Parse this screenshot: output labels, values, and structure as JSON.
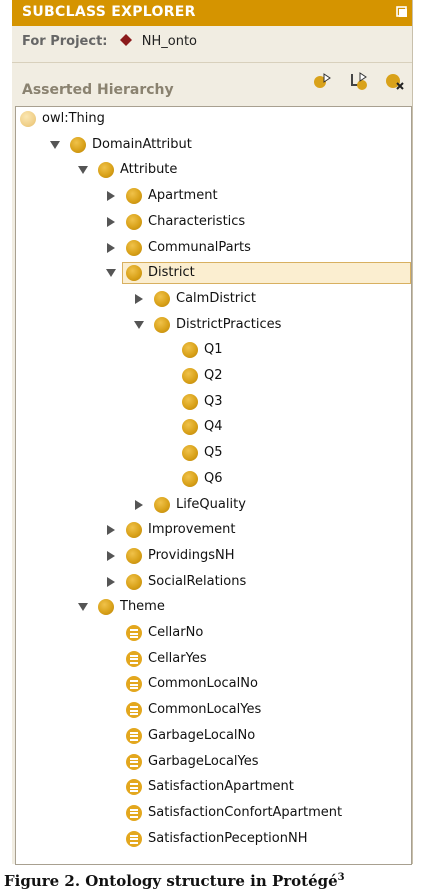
{
  "window": {
    "title": "SUBCLASS EXPLORER"
  },
  "project": {
    "label": "For Project:",
    "name": "NH_onto"
  },
  "hierarchy_label": "Asserted Hierarchy",
  "tree": [
    {
      "label": "owl:Thing",
      "depth": 0,
      "arrow": "none",
      "icon": "owl"
    },
    {
      "label": "DomainAttribut",
      "depth": 1,
      "arrow": "down",
      "icon": "class"
    },
    {
      "label": "Attribute",
      "depth": 2,
      "arrow": "down",
      "icon": "class"
    },
    {
      "label": "Apartment",
      "depth": 3,
      "arrow": "right",
      "icon": "class"
    },
    {
      "label": "Characteristics",
      "depth": 3,
      "arrow": "right",
      "icon": "class"
    },
    {
      "label": "CommunalParts",
      "depth": 3,
      "arrow": "right",
      "icon": "class"
    },
    {
      "label": "District",
      "depth": 3,
      "arrow": "down",
      "icon": "class",
      "selected": true
    },
    {
      "label": "CalmDistrict",
      "depth": 4,
      "arrow": "right",
      "icon": "class"
    },
    {
      "label": "DistrictPractices",
      "depth": 4,
      "arrow": "down",
      "icon": "class"
    },
    {
      "label": "Q1",
      "depth": 5,
      "arrow": "none",
      "icon": "class"
    },
    {
      "label": "Q2",
      "depth": 5,
      "arrow": "none",
      "icon": "class"
    },
    {
      "label": "Q3",
      "depth": 5,
      "arrow": "none",
      "icon": "class"
    },
    {
      "label": "Q4",
      "depth": 5,
      "arrow": "none",
      "icon": "class"
    },
    {
      "label": "Q5",
      "depth": 5,
      "arrow": "none",
      "icon": "class"
    },
    {
      "label": "Q6",
      "depth": 5,
      "arrow": "none",
      "icon": "class"
    },
    {
      "label": "LifeQuality",
      "depth": 4,
      "arrow": "right",
      "icon": "class"
    },
    {
      "label": "Improvement",
      "depth": 3,
      "arrow": "right",
      "icon": "class"
    },
    {
      "label": "ProvidingsNH",
      "depth": 3,
      "arrow": "right",
      "icon": "class"
    },
    {
      "label": "SocialRelations",
      "depth": 3,
      "arrow": "right",
      "icon": "class"
    },
    {
      "label": "Theme",
      "depth": 2,
      "arrow": "down",
      "icon": "class"
    },
    {
      "label": "CellarNo",
      "depth": 3,
      "arrow": "none",
      "icon": "instance"
    },
    {
      "label": "CellarYes",
      "depth": 3,
      "arrow": "none",
      "icon": "instance"
    },
    {
      "label": "CommonLocalNo",
      "depth": 3,
      "arrow": "none",
      "icon": "instance"
    },
    {
      "label": "CommonLocalYes",
      "depth": 3,
      "arrow": "none",
      "icon": "instance"
    },
    {
      "label": "GarbageLocalNo",
      "depth": 3,
      "arrow": "none",
      "icon": "instance"
    },
    {
      "label": "GarbageLocalYes",
      "depth": 3,
      "arrow": "none",
      "icon": "instance"
    },
    {
      "label": "SatisfactionApartment",
      "depth": 3,
      "arrow": "none",
      "icon": "instance"
    },
    {
      "label": "SatisfactionConfortApartment",
      "depth": 3,
      "arrow": "none",
      "icon": "instance"
    },
    {
      "label": "SatisfactionPeceptionNH",
      "depth": 3,
      "arrow": "none",
      "icon": "instance"
    }
  ],
  "caption": "Figure 2. Ontology structure in Protégé",
  "caption_sup": "3",
  "colors": {
    "titlebar": "#d59400",
    "panel": "#f1ede2",
    "class_ball": "#d9a21a",
    "selection": "#fbeed0"
  }
}
